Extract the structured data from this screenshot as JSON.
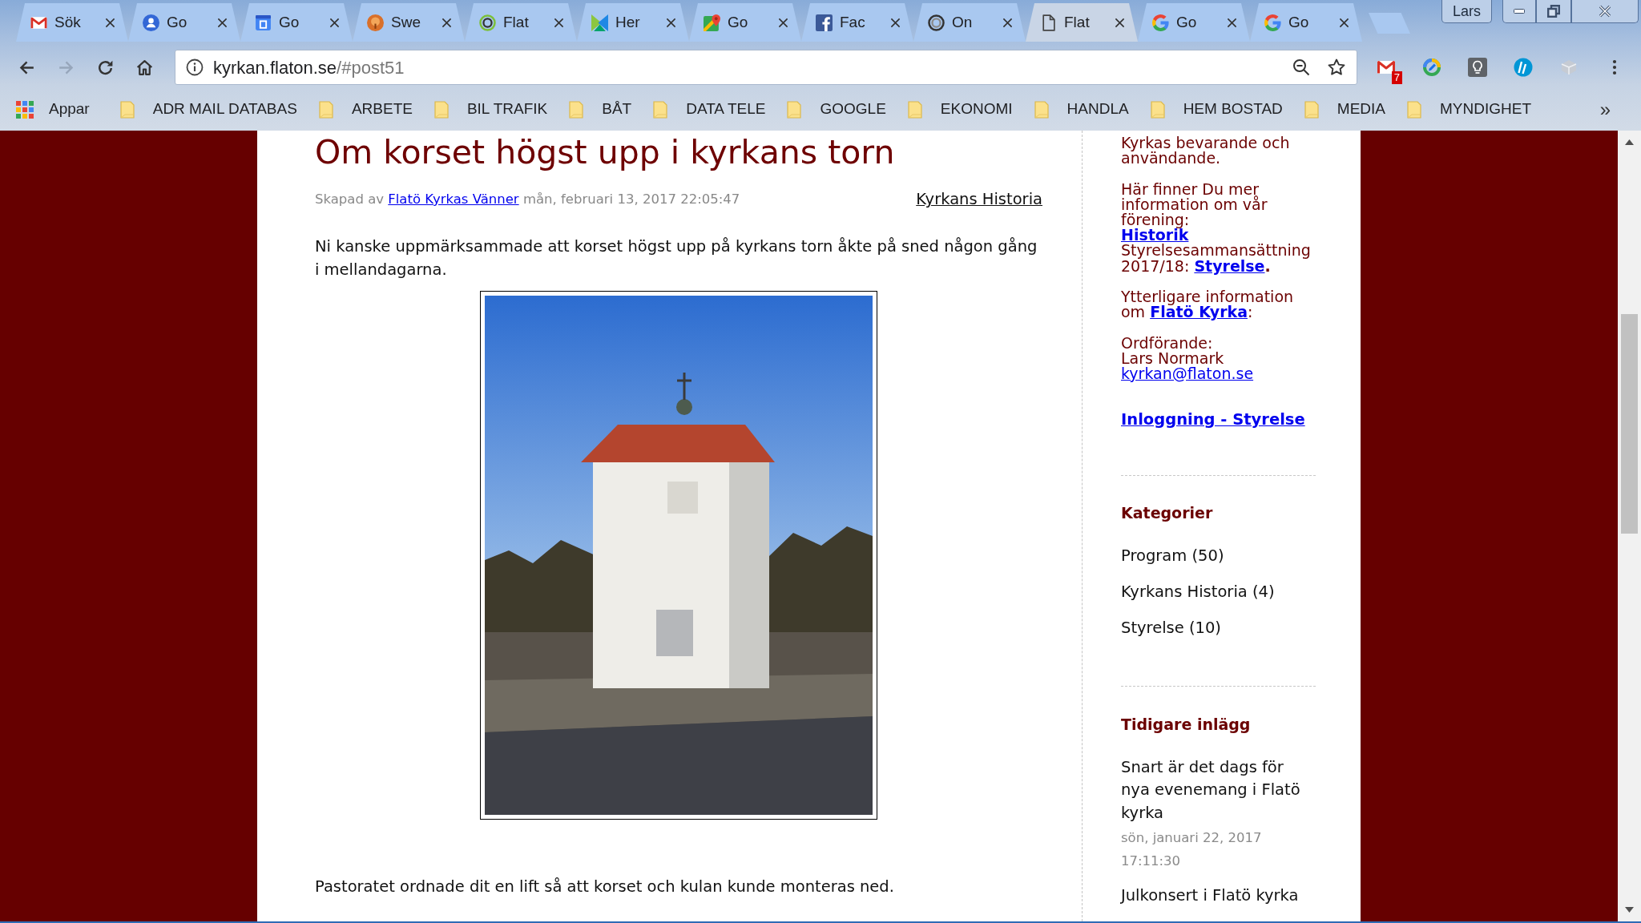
{
  "window": {
    "profile": "Lars"
  },
  "tabs": [
    {
      "label": "Sök",
      "selected": false
    },
    {
      "label": "Go",
      "selected": false
    },
    {
      "label": "Go",
      "selected": false
    },
    {
      "label": "Swe",
      "selected": false
    },
    {
      "label": "Flat",
      "selected": false
    },
    {
      "label": "Her",
      "selected": false
    },
    {
      "label": "Go",
      "selected": false
    },
    {
      "label": "Fac",
      "selected": false
    },
    {
      "label": "On",
      "selected": false
    },
    {
      "label": "Flat",
      "selected": true
    },
    {
      "label": "Go",
      "selected": false
    },
    {
      "label": "Go",
      "selected": false
    }
  ],
  "navigation": [
    {
      "kind": "back",
      "disabled": false
    },
    {
      "kind": "forward",
      "disabled": true
    },
    {
      "kind": "reload",
      "disabled": false
    },
    {
      "kind": "home",
      "disabled": false
    }
  ],
  "address_bar": {
    "host": "kyrkan.flaton.se",
    "path": "/#post51"
  },
  "extension_badge": "7",
  "bookmarks": {
    "apps": "Appar",
    "folders": [
      "ADR MAIL DATABAS",
      "ARBETE",
      "BIL TRAFIK",
      "BÅT",
      "DATA TELE",
      "GOOGLE",
      "EKONOMI",
      "HANDLA",
      "HEM BOSTAD",
      "MEDIA",
      "MYNDIGHET"
    ],
    "overflow": "»"
  },
  "post": {
    "title": "Om korset högst upp i kyrkans torn",
    "byline": {
      "prefix": "Skapad av",
      "author": "Flatö Kyrkas Vänner",
      "date": "mån, februari 13, 2017 22:05:47"
    },
    "category": "Kyrkans Historia",
    "body": [
      {
        "kind": "text",
        "text": "Ni kanske uppmärksammade att korset högst upp på kyrkans torn åkte på sned någon gång i mellandagarna."
      },
      {
        "kind": "photo"
      },
      {
        "kind": "text",
        "text": "Pastoratet ordnade dit en lift så att korset och kulan kunde monteras ned."
      }
    ]
  },
  "sidebar": {
    "about": [
      [
        {
          "kind": "text",
          "text": "Kyrkas bevarande och användande."
        }
      ],
      [
        {
          "kind": "text",
          "text": "Här finner Du mer information om vår förening:"
        },
        {
          "kind": "break"
        },
        {
          "kind": "link",
          "text": "Historik",
          "bold": true
        },
        {
          "kind": "break"
        },
        {
          "kind": "text",
          "text": "Styrelsesammansättning 2017/18: "
        },
        {
          "kind": "link",
          "text": "Styrelse",
          "bold": true
        },
        {
          "kind": "text",
          "text": "**.**"
        }
      ],
      [
        {
          "kind": "text",
          "text": "Ytterligare information om "
        },
        {
          "kind": "link",
          "text": "Flatö Kyrka",
          "bold": true
        },
        {
          "kind": "text",
          "text": ":"
        }
      ],
      [
        {
          "kind": "text",
          "text": "Ordförande:"
        },
        {
          "kind": "break"
        },
        {
          "kind": "text",
          "text": "Lars Normark"
        },
        {
          "kind": "break"
        },
        {
          "kind": "link",
          "text": "kyrkan@flaton.se",
          "bold": false
        }
      ]
    ],
    "login_link": "Inloggning - Styrelse",
    "categories": {
      "title": "Kategorier",
      "items": [
        "Program (50)",
        "Kyrkans Historia (4)",
        "Styrelse (10)"
      ]
    },
    "recent": {
      "title": "Tidigare inlägg",
      "posts": [
        {
          "title": "Snart är det dags för nya evenemang i Flatö kyrka",
          "date": "sön, januari 22, 2017 17:11:30"
        },
        {
          "title": "Julkonsert i Flatö kyrka"
        }
      ]
    }
  }
}
